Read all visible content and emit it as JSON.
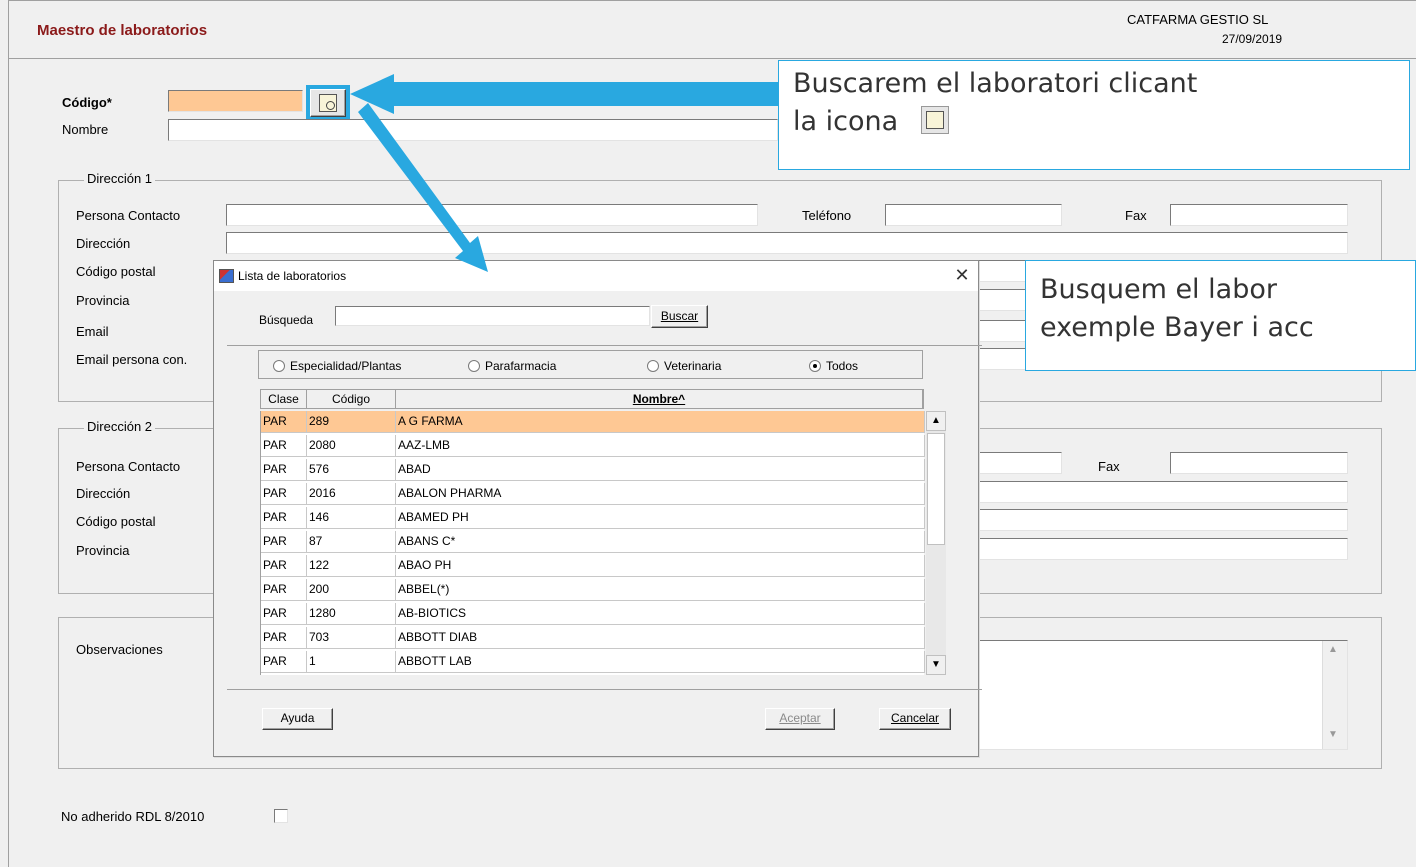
{
  "window": {
    "title": "Maestro de laboratorios",
    "company": "CATFARMA GESTIO SL",
    "date": "27/09/2019"
  },
  "form": {
    "codigo_label": "Código*",
    "nombre_label": "Nombre",
    "direccion1": {
      "title": "Dirección 1",
      "persona_contacto": "Persona Contacto",
      "telefono": "Teléfono",
      "fax": "Fax",
      "direccion": "Dirección",
      "codigo_postal": "Código postal",
      "provincia": "Provincia",
      "email": "Email",
      "email_persona": "Email persona con."
    },
    "direccion2": {
      "title": "Dirección 2",
      "persona_contacto": "Persona Contacto",
      "fax": "Fax",
      "direccion": "Dirección",
      "codigo_postal": "Código postal",
      "provincia": "Provincia"
    },
    "observaciones": "Observaciones",
    "no_adherido": "No adherido RDL 8/2010"
  },
  "callouts": {
    "first_line1": "Buscarem el laboratori clicant",
    "first_line2": "la icona",
    "second_line1": "Busquem el labor",
    "second_line2": "exemple Bayer i acc"
  },
  "dialog": {
    "title": "Lista de laboratorios",
    "search_label": "Búsqueda",
    "search_value": "",
    "buscar_button": "Buscar",
    "filters": [
      {
        "label": "Especialidad/Plantas",
        "selected": false
      },
      {
        "label": "Parafarmacia",
        "selected": false
      },
      {
        "label": "Veterinaria",
        "selected": false
      },
      {
        "label": "Todos",
        "selected": true
      }
    ],
    "columns": [
      "Clase",
      "Código",
      "Nombre^"
    ],
    "rows": [
      [
        "PAR",
        "289",
        "A G FARMA"
      ],
      [
        "PAR",
        "2080",
        "AAZ-LMB"
      ],
      [
        "PAR",
        "576",
        "ABAD"
      ],
      [
        "PAR",
        "2016",
        "ABALON PHARMA"
      ],
      [
        "PAR",
        "146",
        "ABAMED PH"
      ],
      [
        "PAR",
        "87",
        "ABANS C*"
      ],
      [
        "PAR",
        "122",
        "ABAO PH"
      ],
      [
        "PAR",
        "200",
        "ABBEL(*)"
      ],
      [
        "PAR",
        "1280",
        "AB-BIOTICS"
      ],
      [
        "PAR",
        "703",
        "ABBOTT DIAB"
      ],
      [
        "PAR",
        "1",
        "ABBOTT LAB"
      ]
    ],
    "ayuda_button": "Ayuda",
    "aceptar_button": "Aceptar",
    "cancelar_button": "Cancelar"
  },
  "colors": {
    "title": "#8b1a1a",
    "highlight": "#fec894",
    "accent_arrow": "#29a8e0"
  }
}
